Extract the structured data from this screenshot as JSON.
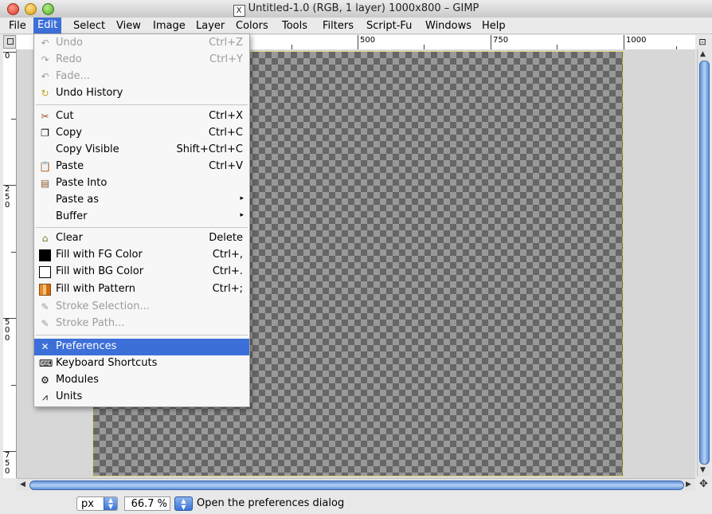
{
  "window": {
    "title": "Untitled-1.0 (RGB, 1 layer) 1000x800 – GIMP"
  },
  "menubar": {
    "items": [
      "File",
      "Edit",
      "Select",
      "View",
      "Image",
      "Layer",
      "Colors",
      "Tools",
      "Filters",
      "Script-Fu",
      "Windows",
      "Help"
    ]
  },
  "ruler": {
    "h_labels": [
      "500",
      "750",
      "1000"
    ],
    "v_labels": [
      "0",
      "2\n5\n0",
      "5\n0\n0",
      "7\n5\n0"
    ]
  },
  "edit_menu": {
    "items": [
      {
        "label": "Undo",
        "shortcut": "Ctrl+Z",
        "icon": "undo-icon",
        "disabled": true
      },
      {
        "label": "Redo",
        "shortcut": "Ctrl+Y",
        "icon": "redo-icon",
        "disabled": true
      },
      {
        "label": "Fade...",
        "shortcut": "",
        "icon": "fade-icon",
        "disabled": true
      },
      {
        "label": "Undo History",
        "shortcut": "",
        "icon": "undo-history-icon",
        "disabled": false
      },
      {
        "label": "Cut",
        "shortcut": "Ctrl+X",
        "icon": "scissors-icon",
        "disabled": false
      },
      {
        "label": "Copy",
        "shortcut": "Ctrl+C",
        "icon": "copy-icon",
        "disabled": false
      },
      {
        "label": "Copy Visible",
        "shortcut": "Shift+Ctrl+C",
        "icon": "",
        "disabled": false
      },
      {
        "label": "Paste",
        "shortcut": "Ctrl+V",
        "icon": "paste-icon",
        "disabled": false
      },
      {
        "label": "Paste Into",
        "shortcut": "",
        "icon": "paste-into-icon",
        "disabled": false
      },
      {
        "label": "Paste as",
        "shortcut": "",
        "icon": "",
        "disabled": false,
        "submenu": true
      },
      {
        "label": "Buffer",
        "shortcut": "",
        "icon": "",
        "disabled": false,
        "submenu": true
      },
      {
        "label": "Clear",
        "shortcut": "Delete",
        "icon": "clear-icon",
        "disabled": false
      },
      {
        "label": "Fill with FG Color",
        "shortcut": "Ctrl+,",
        "icon": "fg-color-icon",
        "disabled": false
      },
      {
        "label": "Fill with BG Color",
        "shortcut": "Ctrl+.",
        "icon": "bg-color-icon",
        "disabled": false
      },
      {
        "label": "Fill with Pattern",
        "shortcut": "Ctrl+;",
        "icon": "pattern-icon",
        "disabled": false
      },
      {
        "label": "Stroke Selection...",
        "shortcut": "",
        "icon": "stroke-selection-icon",
        "disabled": true
      },
      {
        "label": "Stroke Path...",
        "shortcut": "",
        "icon": "stroke-path-icon",
        "disabled": true
      },
      {
        "label": "Preferences",
        "shortcut": "",
        "icon": "preferences-icon",
        "disabled": false,
        "highlighted": true
      },
      {
        "label": "Keyboard Shortcuts",
        "shortcut": "",
        "icon": "keyboard-icon",
        "disabled": false
      },
      {
        "label": "Modules",
        "shortcut": "",
        "icon": "modules-icon",
        "disabled": false
      },
      {
        "label": "Units",
        "shortcut": "",
        "icon": "units-icon",
        "disabled": false
      }
    ]
  },
  "statusbar": {
    "unit": "px",
    "zoom": "66.7 %",
    "message": "Open the preferences dialog"
  },
  "colors": {
    "menu_highlight": "#3d6fd9",
    "scroll_thumb": "#5f8fd8"
  }
}
